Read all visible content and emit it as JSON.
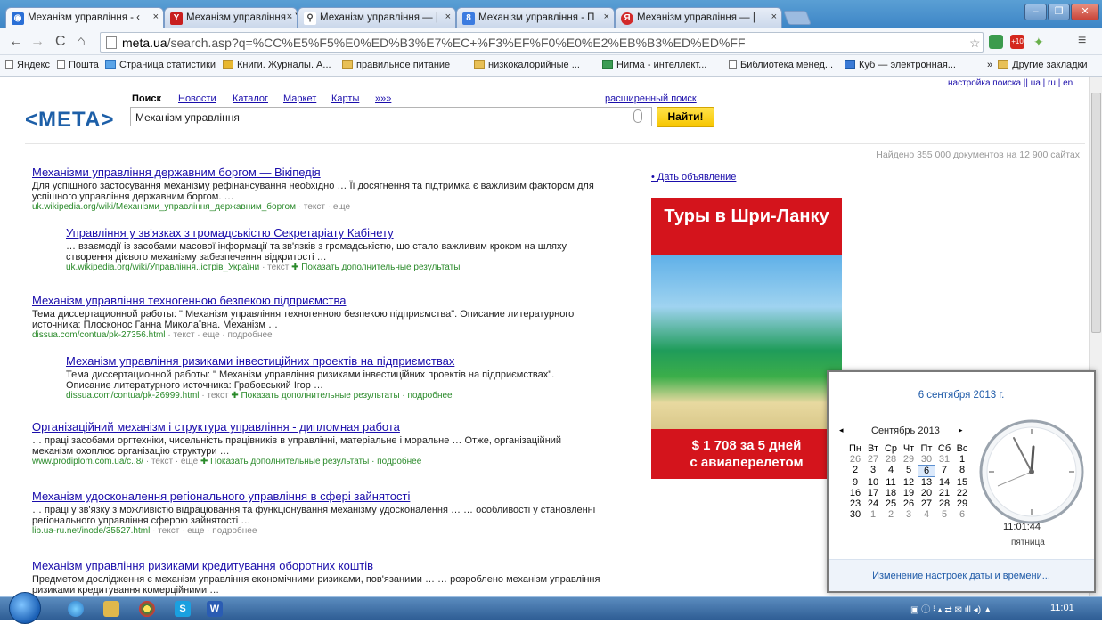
{
  "tabs": [
    {
      "label": "Механізм управління - ‹",
      "active": true,
      "favicon": "globe-icon",
      "color": "#2a6fd6"
    },
    {
      "label": "Механізм управління - Y",
      "favicon": "yandex-icon",
      "color": "#c81e1e"
    },
    {
      "label": "Механізм управління — |",
      "favicon": "search-icon",
      "color": "#444444"
    },
    {
      "label": "Механізм управління - П",
      "favicon": "google-icon",
      "color": "#3b7be0"
    },
    {
      "label": "Механізм управління — |",
      "favicon": "yandex-circle-icon",
      "color": "#d22a2a"
    }
  ],
  "toolbar": {
    "url_host": "meta.ua",
    "url_path": "/search.asp?q=%CC%E5%F5%E0%ED%B3%E7%EC+%F3%EF%F0%E0%E2%EB%B3%ED%ED%FF",
    "badge": "+10"
  },
  "bookmarks": [
    {
      "label": "Яндекс",
      "icon": "page"
    },
    {
      "label": "Пошта",
      "icon": "page"
    },
    {
      "label": "Страница статистики",
      "icon": "page"
    },
    {
      "label": "Книги. Журналы. А...",
      "icon": "page"
    },
    {
      "label": "правильное питание",
      "icon": "folder"
    },
    {
      "label": "низкокалорийные ...",
      "icon": "folder"
    },
    {
      "label": "Нигма - интеллект...",
      "icon": "page"
    },
    {
      "label": "Библиотека менед...",
      "icon": "page"
    },
    {
      "label": "Куб — электронная...",
      "icon": "page"
    },
    {
      "label": "Другие закладки",
      "icon": "folder"
    }
  ],
  "page": {
    "settings_link": "настройка поиска || ua | ru | en",
    "logo": "<МЕТА>",
    "nav": [
      "Поиск",
      "Новости",
      "Каталог",
      "Маркет",
      "Карты",
      "»»»"
    ],
    "advanced": "расширенный поиск",
    "query": "Механізм управління",
    "find_button": "Найти!",
    "found": "Найдено 355 000 документов на 12 900 сайтах",
    "ad_link": "• Дать объявление",
    "ad_title": "Туры в Шри-Ланку",
    "ad_price": "$ 1 708 за 5 дней",
    "ad_price2": "с авиаперелетом"
  },
  "results": [
    {
      "title": "Механізми управління державним боргом — Вікіпедія",
      "snippet": "Для успішного застосування механізму рефінансування необхідно … Її досягнення та підтримка є важливим фактором для успішного управління державним боргом. …",
      "url": "uk.wikipedia.org/wiki/Механізми_управління_державним_боргом",
      "meta": "· текст · еще"
    },
    {
      "title": "Управління у зв'язках з громадськістю Секретаріату Кабінету",
      "snippet": "… взаємодії із засобами масової інформації та зв'язків з громадськістю, що стало важливим кроком на шляху створення дієвого механізму забезпечення відкритості …",
      "url": "uk.wikipedia.org/wiki/Управління..істрів_України",
      "meta": "· текст",
      "more": "✚ Показать дополнительные результаты"
    },
    {
      "title": "Механізм управління техногенною безпекою підприємства",
      "snippet": "Тема диссертационной работы: \" Механізм управління техногенною безпекою підприємства\". Описание литературного источника: Плосконос Ганна Миколаївна. Механізм …",
      "url": "dissua.com/contua/pk-27356.html",
      "meta": "· текст · еще · подробнее"
    },
    {
      "title": "Механізм управління ризиками інвестиційних проектів на підприємствах",
      "snippet": "Тема диссертационной работы: \" Механізм управління ризиками інвестиційних проектів на підприємствах\". Описание литературного источника: Грабовський Ігор …",
      "url": "dissua.com/contua/pk-26999.html",
      "meta": "· текст",
      "more": "✚ Показать дополнительные результаты · подробнее"
    },
    {
      "title": "Організаційний механізм і структура управління - дипломная работа",
      "snippet": "… праці засобами оргтехніки, чисельність працівників в управлінні, матеріальне і моральне … Отже, організаційний механізм охоплює організацію структури …",
      "url": "www.prodiplom.com.ua/c..8/",
      "meta": "· текст · еще",
      "more": "✚ Показать дополнительные результаты · подробнее"
    },
    {
      "title": "Механізм удосконалення регіонального управління в сфері зайнятості",
      "snippet": "… праці у зв'язку з можливістю відрацювання та функціонування механізму удосконалення … … особливості у становленні регіонального управління сферою зайнятості …",
      "url": "lib.ua-ru.net/inode/35527.html",
      "meta": "· текст · еще · подробнее"
    },
    {
      "title": "Механізм управління ризиками кредитування оборотних коштів",
      "snippet": "Предметом дослідження є механізм управління економічними ризиками, пов'язаними … … розроблено механізм управління ризиками кредитування комерційними …",
      "url": "",
      "meta": ""
    }
  ],
  "clock": {
    "date": "6 сентября 2013 г.",
    "month": "Сентябрь 2013",
    "weekdays": [
      "Пн",
      "Вт",
      "Ср",
      "Чт",
      "Пт",
      "Сб",
      "Вс"
    ],
    "weeks": [
      [
        "26",
        "27",
        "28",
        "29",
        "30",
        "31",
        "1"
      ],
      [
        "2",
        "3",
        "4",
        "5",
        "6",
        "7",
        "8"
      ],
      [
        "9",
        "10",
        "11",
        "12",
        "13",
        "14",
        "15"
      ],
      [
        "16",
        "17",
        "18",
        "19",
        "20",
        "21",
        "22"
      ],
      [
        "23",
        "24",
        "25",
        "26",
        "27",
        "28",
        "29"
      ],
      [
        "30",
        "1",
        "2",
        "3",
        "4",
        "5",
        "6"
      ]
    ],
    "time": "11:01:44",
    "weekday": "пятница",
    "footer": "Изменение настроек даты и времени..."
  },
  "taskbar": {
    "time": "11:01"
  }
}
